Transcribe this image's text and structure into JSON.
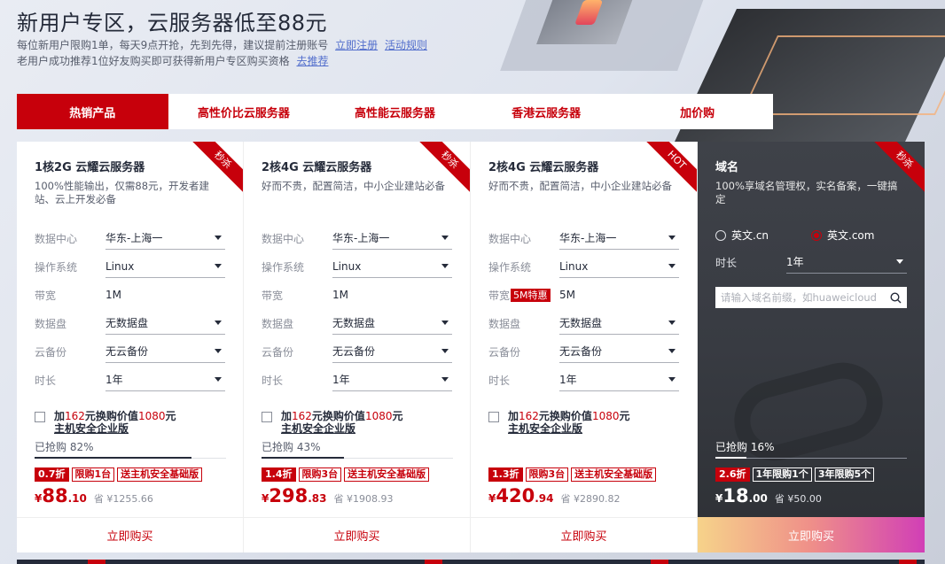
{
  "header": {
    "title": "新用户专区，云服务器低至88元",
    "line1": "每位新用户限购1单，每天9点开抢，先到先得，建议提前注册账号",
    "register_link": "立即注册",
    "rules_link": "活动规则",
    "line2": "老用户成功推荐1位好友购买即可获得新用户专区购买资格",
    "recommend_link": "去推荐"
  },
  "tabs": [
    {
      "label": "热销产品"
    },
    {
      "label": "高性价比云服务器"
    },
    {
      "label": "高性能云服务器"
    },
    {
      "label": "香港云服务器"
    },
    {
      "label": "加价购"
    }
  ],
  "cards": [
    {
      "ribbon": "秒杀",
      "title": "1核2G 云耀云服务器",
      "desc": "100%性能输出，仅需88元，开发者建站、云上开发必备",
      "fields": {
        "datacenter": {
          "label": "数据中心",
          "value": "华东-上海一"
        },
        "os": {
          "label": "操作系统",
          "value": "Linux"
        },
        "bandwidth": {
          "label": "带宽",
          "value": "1M"
        },
        "disk": {
          "label": "数据盘",
          "value": "无数据盘"
        },
        "backup": {
          "label": "云备份",
          "value": "无云备份"
        },
        "duration": {
          "label": "时长",
          "value": "1年"
        }
      },
      "addon": {
        "p1": "加",
        "p2": "162",
        "p3": "元换购价值",
        "p4": "1080",
        "p5": "元",
        "name": "主机安全企业版"
      },
      "sold": {
        "label": "已抢购 82%",
        "percent": 82
      },
      "badges": [
        "0.7折",
        "限购1台",
        "送主机安全基础版"
      ],
      "price": {
        "currency": "¥",
        "int": "88",
        "dec": ".10",
        "save": "省 ¥1255.66"
      },
      "buy": "立即购买"
    },
    {
      "ribbon": "秒杀",
      "title": "2核4G 云耀云服务器",
      "desc": "好而不贵，配置简洁，中小企业建站必备",
      "fields": {
        "datacenter": {
          "label": "数据中心",
          "value": "华东-上海一"
        },
        "os": {
          "label": "操作系统",
          "value": "Linux"
        },
        "bandwidth": {
          "label": "带宽",
          "value": "1M"
        },
        "disk": {
          "label": "数据盘",
          "value": "无数据盘"
        },
        "backup": {
          "label": "云备份",
          "value": "无云备份"
        },
        "duration": {
          "label": "时长",
          "value": "1年"
        }
      },
      "addon": {
        "p1": "加",
        "p2": "162",
        "p3": "元换购价值",
        "p4": "1080",
        "p5": "元",
        "name": "主机安全企业版"
      },
      "sold": {
        "label": "已抢购 43%",
        "percent": 43
      },
      "badges": [
        "1.4折",
        "限购3台",
        "送主机安全基础版"
      ],
      "price": {
        "currency": "¥",
        "int": "298",
        "dec": ".83",
        "save": "省 ¥1908.93"
      },
      "buy": "立即购买"
    },
    {
      "ribbon": "HOT",
      "title": "2核4G 云耀云服务器",
      "desc": "好而不贵，配置简洁，中小企业建站必备",
      "fields": {
        "datacenter": {
          "label": "数据中心",
          "value": "华东-上海一"
        },
        "os": {
          "label": "操作系统",
          "value": "Linux"
        },
        "bandwidth": {
          "label": "带宽",
          "tag": "5M特惠",
          "value": "5M"
        },
        "disk": {
          "label": "数据盘",
          "value": "无数据盘"
        },
        "backup": {
          "label": "云备份",
          "value": "无云备份"
        },
        "duration": {
          "label": "时长",
          "value": "1年"
        }
      },
      "addon": {
        "p1": "加",
        "p2": "162",
        "p3": "元换购价值",
        "p4": "1080",
        "p5": "元",
        "name": "主机安全企业版"
      },
      "badges": [
        "1.3折",
        "限购3台",
        "送主机安全基础版"
      ],
      "price": {
        "currency": "¥",
        "int": "420",
        "dec": ".94",
        "save": "省 ¥2890.82"
      },
      "buy": "立即购买"
    },
    {
      "ribbon": "秒杀",
      "title": "域名",
      "desc": "100%享域名管理权，实名备案，一键搞定",
      "radios": [
        "英文.cn",
        "英文.com"
      ],
      "selected_radio": "英文.com",
      "duration": {
        "label": "时长",
        "value": "1年"
      },
      "search_placeholder": "请输入域名前缀，如huaweicloud",
      "sold": {
        "label": "已抢购 16%",
        "percent": 16
      },
      "badges": [
        "2.6折",
        "1年限购1个",
        "3年限购5个"
      ],
      "price": {
        "currency": "¥",
        "int": "18",
        "dec": ".00",
        "save": "省 ¥50.00"
      },
      "buy": "立即购买"
    }
  ],
  "colors": {
    "brand_red": "#c7000b",
    "dark_card": "#3a3d44",
    "link_blue": "#526ecc"
  },
  "icons": {
    "search": "search-icon",
    "caret": "chevron-down-icon"
  }
}
